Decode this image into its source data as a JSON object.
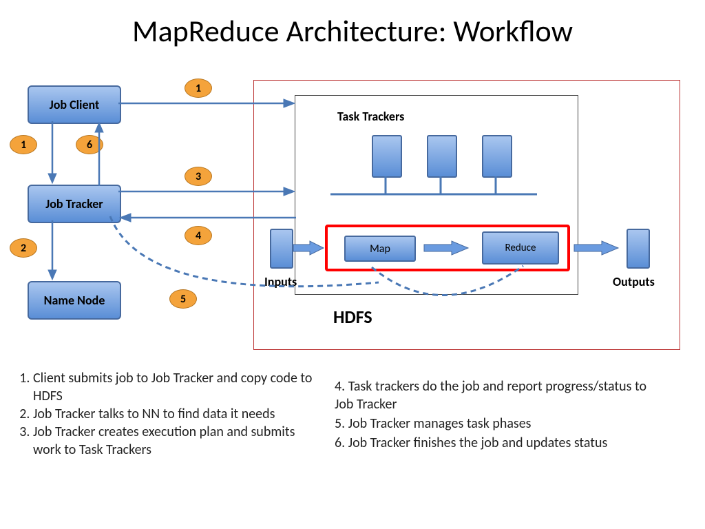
{
  "title": "MapReduce Architecture: Workflow",
  "nodes": {
    "job_client": "Job Client",
    "job_tracker": "Job Tracker",
    "name_node": "Name Node",
    "task_trackers": "Task Trackers",
    "map": "Map",
    "reduce": "Reduce",
    "inputs": "Inputs",
    "outputs": "Outputs",
    "hdfs": "HDFS"
  },
  "badges": {
    "b1a": "1",
    "b1b": "1",
    "b2": "2",
    "b3": "3",
    "b4": "4",
    "b5": "5",
    "b6": "6"
  },
  "steps_left": [
    "Client submits job to Job Tracker and copy code to HDFS",
    "Job Tracker talks to NN to find data it needs",
    "Job Tracker creates execution plan and submits work to Task Trackers"
  ],
  "steps_right": [
    "4.  Task trackers do the job and report progress/status to Job Tracker",
    "5.  Job Tracker manages task phases",
    "6.  Job Tracker finishes the job and updates status"
  ]
}
